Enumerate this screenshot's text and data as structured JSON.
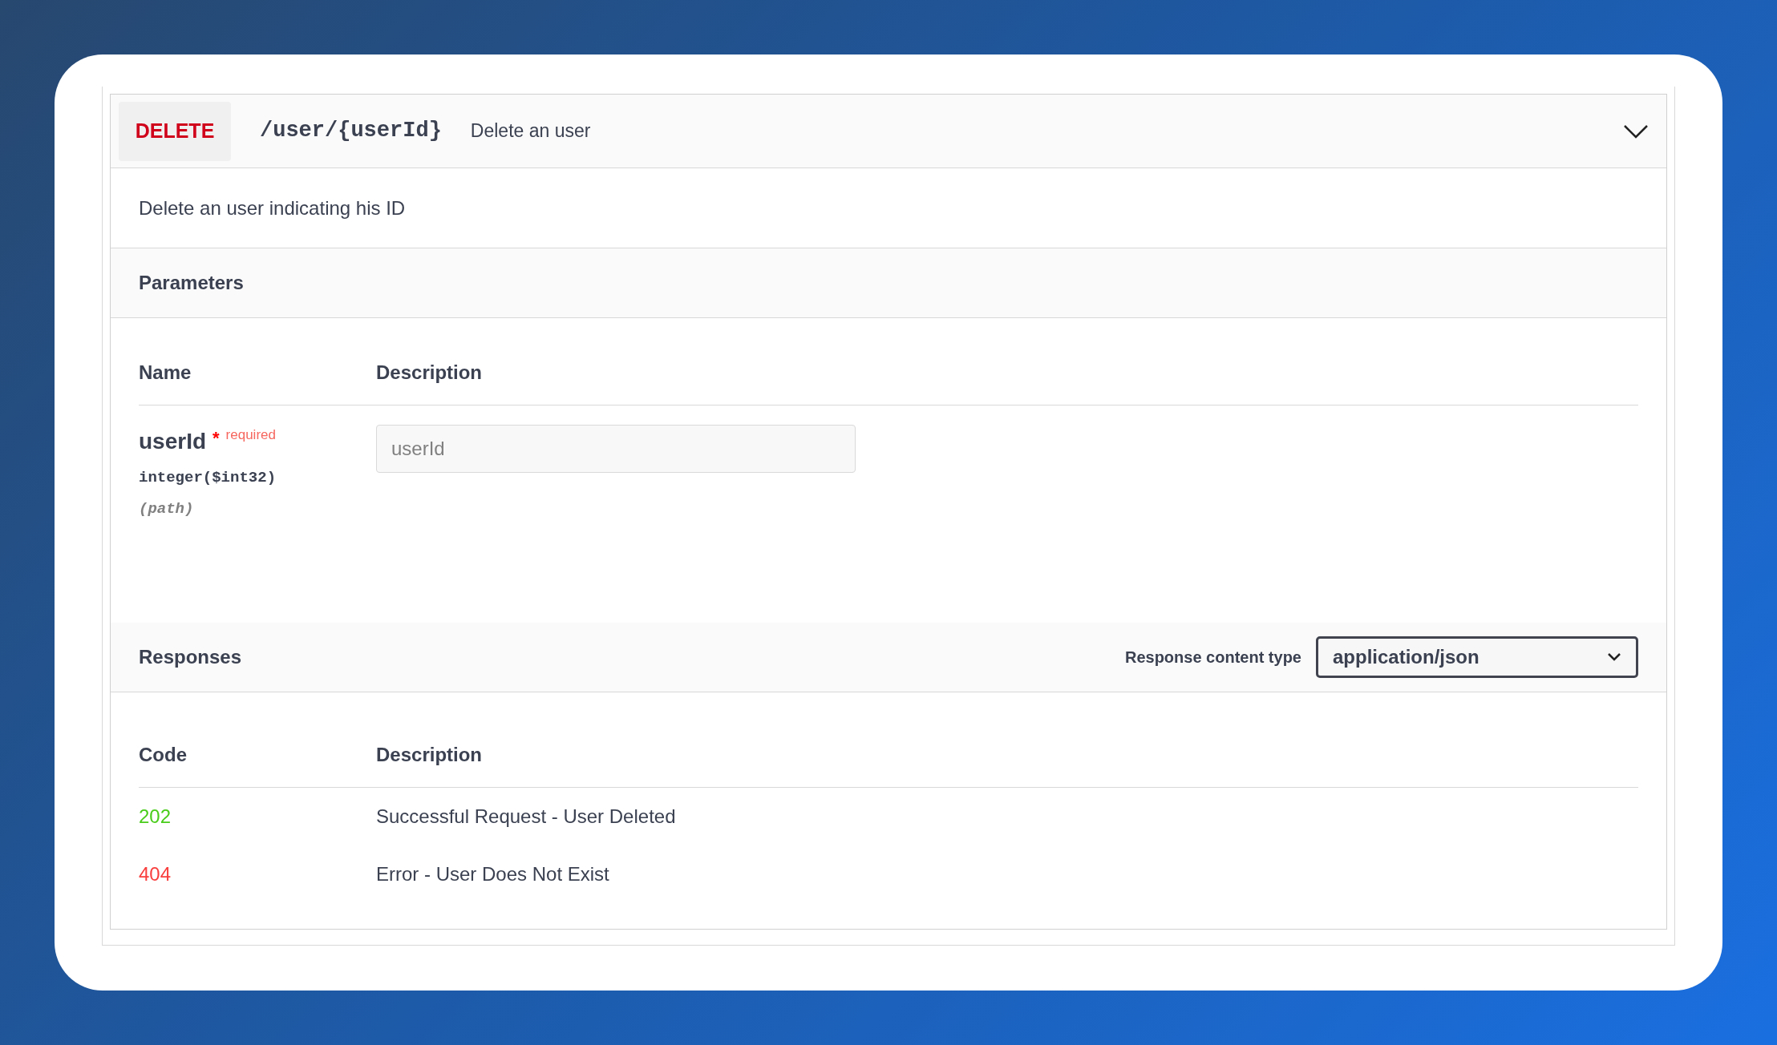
{
  "operation": {
    "method": "DELETE",
    "path": "/user/{userId}",
    "summary": "Delete an user",
    "expanded": true
  },
  "description": "Delete an user indicating his ID",
  "parameters": {
    "title": "Parameters",
    "columns": [
      "Name",
      "Description"
    ],
    "rows": [
      {
        "name": "userId",
        "required_mark": "*",
        "required_label": "required",
        "type": "integer($int32)",
        "location": "(path)",
        "placeholder": "userId"
      }
    ]
  },
  "responses": {
    "title": "Responses",
    "content_type_label": "Response content type",
    "content_type": "application/json",
    "columns": [
      "Code",
      "Description"
    ],
    "rows": [
      {
        "code": "202",
        "color": "#49cc1a",
        "description": "Successful Request - User Deleted"
      },
      {
        "code": "404",
        "color": "#f93e3e",
        "description": "Error - User Does Not Exist"
      }
    ]
  }
}
